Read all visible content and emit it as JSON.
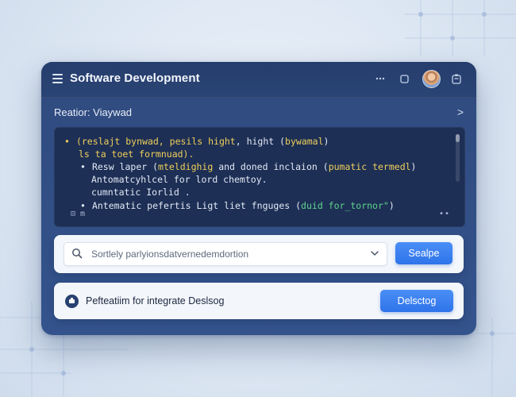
{
  "window": {
    "title": "Software Development"
  },
  "titlebar": {
    "more_icon": "ellipsis-icon",
    "square_icon": "window-square-icon",
    "avatar_icon": "user-avatar",
    "clipboard_icon": "clipboard-icon"
  },
  "subheader": {
    "label": "Reatior: Viaywad",
    "chevron": ">"
  },
  "code": {
    "line1_prefix": "(reslajt bynwad, ",
    "line1_highlight": "pesils hight",
    "line1_mid": ", hight (",
    "line1_highlight2": "bywamal",
    "line1_suffix": ")",
    "line2": "ls ta toet formnuad).",
    "line3_prefix": "Resw laper (",
    "line3_highlight": "mteldighig",
    "line3_mid": " and doned inclaion (",
    "line3_highlight2": "pumatic termedl",
    "line3_suffix": ")",
    "line4": "Antomatcyhlcel for lord chemtoy.",
    "line5": "cumntatic Iorlid .",
    "line6_prefix": "Antematic pefertis Ligt liet fnguges (",
    "line6_highlight": "duid for_tornor\"",
    "line6_suffix": ")",
    "footer_left": "⊡ m",
    "footer_right": "••"
  },
  "search": {
    "placeholder": "Sortlely parlyionsdatvernedemdortion",
    "button_label": "Sealpe"
  },
  "action": {
    "label": "Pefteatiim for integrate Deslsog",
    "button_label": "Delsctog"
  },
  "colors": {
    "accent": "#3b82f6",
    "window_bg": "#2f4a7e",
    "code_bg": "#1d2f55",
    "code_highlight_yellow": "#f0cf5a",
    "code_highlight_green": "#5fd38c"
  }
}
